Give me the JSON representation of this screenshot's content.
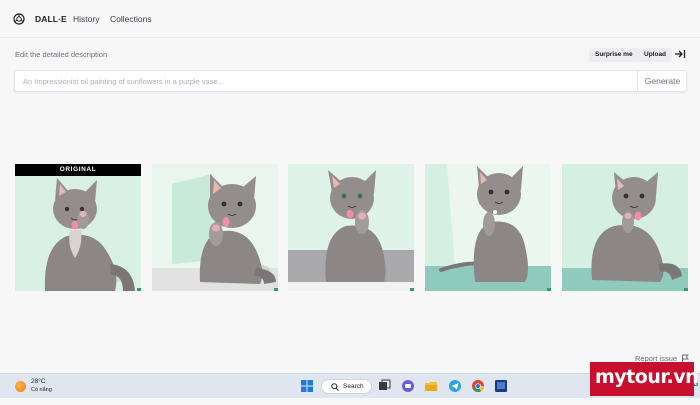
{
  "header": {
    "brand": "DALL·E",
    "nav": [
      "History",
      "Collections"
    ]
  },
  "edit": {
    "label": "Edit the detailed description",
    "surprise_label": "Surprise me",
    "upload_label": "Upload"
  },
  "prompt": {
    "placeholder": "An Impressionist oil painting of sunflowers in a purple vase...",
    "value": "",
    "generate_label": "Generate"
  },
  "gallery": {
    "original_badge": "ORIGINAL",
    "images": [
      {
        "role": "original",
        "subject": "grey kitten licking paw"
      },
      {
        "role": "variation",
        "subject": "grey kitten with paw raised"
      },
      {
        "role": "variation",
        "subject": "grey kitten sitting on grey floor"
      },
      {
        "role": "variation",
        "subject": "grey kitten with tail out on teal floor"
      },
      {
        "role": "variation",
        "subject": "grey kitten sitting on teal background"
      }
    ]
  },
  "footer": {
    "report_label": "Report issue"
  },
  "taskbar": {
    "temperature": "28°C",
    "condition": "Có nắng",
    "search_label": "Search",
    "tray_letter": "G"
  },
  "watermark": {
    "text": "mytour.vn"
  },
  "colors": {
    "background": "#f7f7f8",
    "mint": "#d9f0e4",
    "teal_floor": "#8fcbbd",
    "cat_grey": "#8c8786",
    "tongue_pink": "#f08fa8",
    "watermark_red": "#c8102e"
  }
}
